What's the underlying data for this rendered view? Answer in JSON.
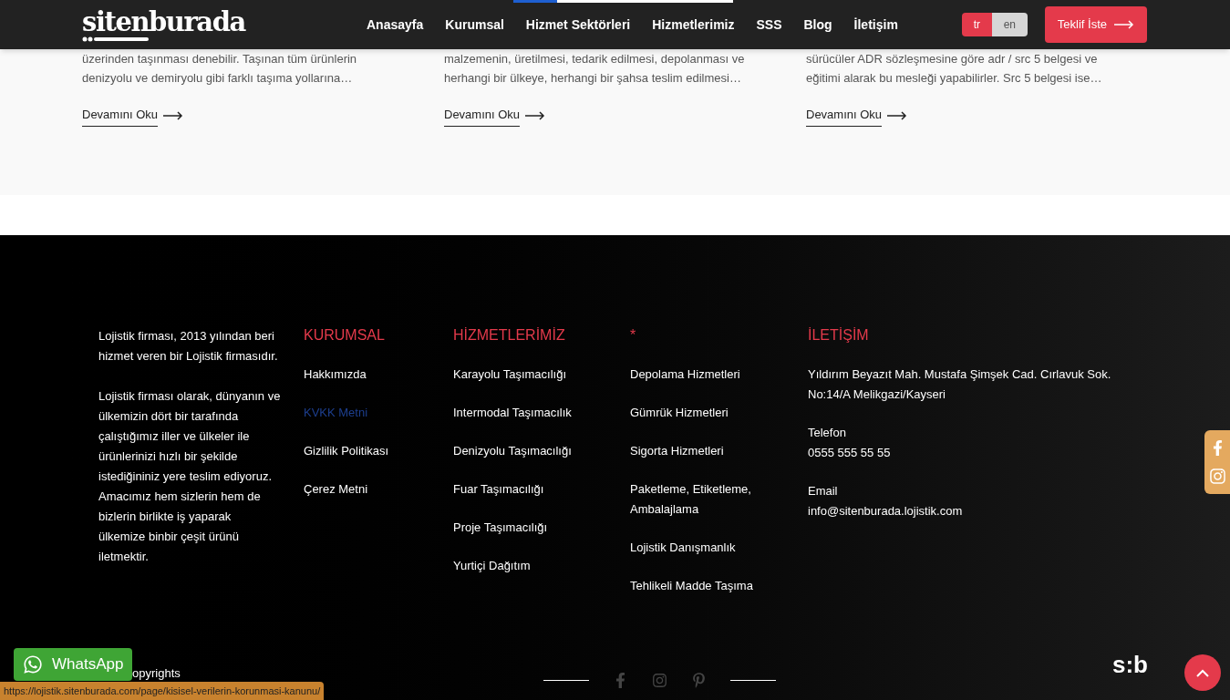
{
  "header": {
    "logo": "sitenburada",
    "nav": [
      {
        "label": "Anasayfa"
      },
      {
        "label": "Kurumsal"
      },
      {
        "label": "Hizmet Sektörleri"
      },
      {
        "label": "Hizmetlerimiz"
      },
      {
        "label": "SSS"
      },
      {
        "label": "Blog"
      },
      {
        "label": "İletişim"
      }
    ],
    "languages": [
      {
        "label": "tr",
        "selected": true
      },
      {
        "label": "en",
        "selected": false
      }
    ],
    "cta": "Teklif İste",
    "slider_progress": {
      "level": 0.2
    }
  },
  "cards": [
    {
      "text": "üzerinden taşınması denebilir. Taşınan tüm ürünlerin denizyolu ve demiryolu gibi farklı taşıma yollarına…",
      "link": "Devamını Oku"
    },
    {
      "text": "malzemenin, üretilmesi, tedarik edilmesi, depolanması ve herhangi bir  ülkeye, herhangi bir şahsa teslim edilmesi…",
      "link": "Devamını Oku"
    },
    {
      "text": "sürücüler ADR sözleşmesine göre adr / src 5 belgesi ve eğitimi alarak bu mesleği yapabilirler. Src 5 belgesi ise…",
      "link": "Devamını Oku"
    }
  ],
  "footer": {
    "about": [
      "Lojistik firması, 2013 yılından beri hizmet veren bir Lojistik firmasıdır.",
      "Lojistik firması olarak, dünyanın ve ülkemizin dört bir tarafında çalıştığımız iller ve ülkeler ile ürünlerinizi hızlı bir şekilde istediğininiz yere teslim ediyoruz. Amacımız hem sizlerin hem de bizlerin birlikte iş yaparak ülkemize binbir çeşit ürünü iletmektir."
    ],
    "columns": [
      {
        "title": "KURUMSAL",
        "links": [
          {
            "label": "Hakkımızda",
            "hovered": false
          },
          {
            "label": "KVKK Metni",
            "hovered": true
          },
          {
            "label": "Gizlilik Politikası",
            "hovered": false
          },
          {
            "label": "Çerez Metni",
            "hovered": false
          }
        ]
      },
      {
        "title": "HİZMETLERİMİZ",
        "links": [
          {
            "label": "Karayolu Taşımacılığı",
            "hovered": false
          },
          {
            "label": "Intermodal Taşımacılık",
            "hovered": false
          },
          {
            "label": "Denizyolu Taşımacılığı",
            "hovered": false
          },
          {
            "label": "Fuar Taşımacılığı",
            "hovered": false
          },
          {
            "label": "Proje Taşımacılığı",
            "hovered": false
          },
          {
            "label": "Yurtiçi Dağıtım",
            "hovered": false
          }
        ]
      },
      {
        "title": "*",
        "links": [
          {
            "label": "Depolama Hizmetleri",
            "hovered": false
          },
          {
            "label": "Gümrük Hizmetleri",
            "hovered": false
          },
          {
            "label": "Sigorta Hizmetleri",
            "hovered": false
          },
          {
            "label": "Paketleme, Etiketleme, Ambalajlama",
            "hovered": false
          },
          {
            "label": "Lojistik Danışmanlık",
            "hovered": false
          },
          {
            "label": "Tehlikeli Madde Taşıma",
            "hovered": false
          }
        ]
      }
    ],
    "contact": {
      "title": "İLETİŞİM",
      "address": "Yıldırım Beyazıt Mah. Mustafa Şimşek Cad. Cırlavuk Sok. No:14/A Melikgazi/Kayseri",
      "phone_label": "Telefon",
      "phone": "0555 555 55 55",
      "email_label": "Email",
      "email": "info@sitenburada.lojistik.com"
    },
    "copyright": "opyrights",
    "small_logo": "s:b"
  },
  "whatsapp": "WhatsApp",
  "status_bar": {
    "url": "https://lojistik.sitenburada.com/page/kisisel-verilerin-korunmasi-kanunu/"
  }
}
